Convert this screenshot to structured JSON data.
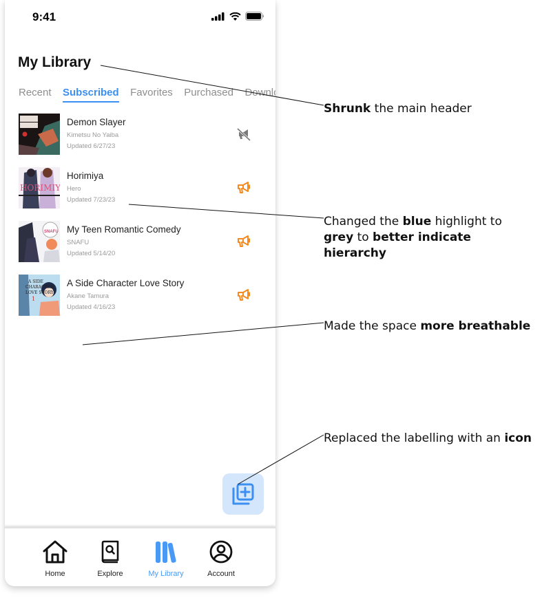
{
  "status_bar": {
    "time": "9:41",
    "icons": [
      "signal-icon",
      "wifi-icon",
      "battery-icon"
    ]
  },
  "header": {
    "title": "My Library"
  },
  "tabs": [
    {
      "label": "Recent",
      "active": false
    },
    {
      "label": "Subscribed",
      "active": true
    },
    {
      "label": "Favorites",
      "active": false
    },
    {
      "label": "Purchased",
      "active": false
    },
    {
      "label": "Downloads",
      "active": false
    }
  ],
  "library_items": [
    {
      "title": "Demon Slayer",
      "subtitle": "Kimetsu No Yaiba",
      "updated": "Updated 6/27/23",
      "notification": "muted",
      "icon": "megaphone-muted-icon"
    },
    {
      "title": "Horimiya",
      "subtitle": "Hero",
      "updated": "Updated 7/23/23",
      "notification": "on",
      "icon": "megaphone-icon"
    },
    {
      "title": "My Teen Romantic Comedy",
      "subtitle": "SNAFU",
      "updated": "Updated 5/14/20",
      "notification": "on",
      "icon": "megaphone-icon"
    },
    {
      "title": "A Side Character Love Story",
      "subtitle": "Akane Tamura",
      "updated": "Updated 4/16/23",
      "notification": "on",
      "icon": "megaphone-icon"
    }
  ],
  "fab": {
    "icon": "add-to-library-icon"
  },
  "bottom_nav": [
    {
      "label": "Home",
      "icon": "home-icon",
      "active": false
    },
    {
      "label": "Explore",
      "icon": "explore-book-icon",
      "active": false
    },
    {
      "label": "My Library",
      "icon": "library-books-icon",
      "active": true
    },
    {
      "label": "Account",
      "icon": "account-icon",
      "active": false
    }
  ],
  "annotations": [
    {
      "parts": [
        {
          "text": "Shrunk",
          "bold": true
        },
        {
          "text": " the main header",
          "bold": false
        }
      ]
    },
    {
      "parts": [
        {
          "text": "Changed the ",
          "bold": false
        },
        {
          "text": "blue",
          "bold": true
        },
        {
          "text": " highlight to ",
          "bold": false
        },
        {
          "text": "grey",
          "bold": true
        },
        {
          "text": " to ",
          "bold": false
        },
        {
          "text": "better indicate hierarchy",
          "bold": true
        }
      ]
    },
    {
      "parts": [
        {
          "text": "Made the space ",
          "bold": false
        },
        {
          "text": "more breathable",
          "bold": true
        }
      ]
    },
    {
      "parts": [
        {
          "text": "Replaced the labelling with an ",
          "bold": false
        },
        {
          "text": "icon",
          "bold": true
        }
      ]
    }
  ],
  "colors": {
    "accent": "#3b8ff0",
    "notify_on": "#f5891f",
    "notify_muted": "#7a7a7a",
    "fab_bg": "#d4e6fb"
  }
}
